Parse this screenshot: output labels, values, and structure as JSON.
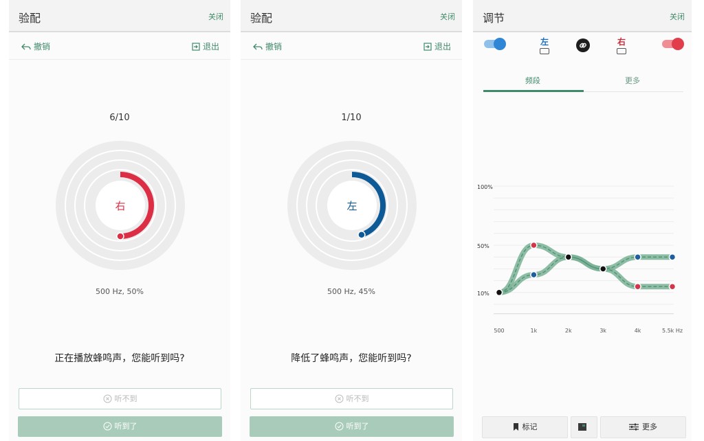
{
  "panels": [
    {
      "title": "验配",
      "close": "关闭",
      "undo": "撤销",
      "exit": "退出",
      "counter": "6/10",
      "ear": "右",
      "ear_color": "#dc2e45",
      "level_fraction": 0.5,
      "freq_info": "500 Hz, 50%",
      "question": "正在播放蜂鸣声，您能听到吗?",
      "btn_no": "听不到",
      "btn_yes": "听到了"
    },
    {
      "title": "验配",
      "close": "关闭",
      "undo": "撤销",
      "exit": "退出",
      "counter": "1/10",
      "ear": "左",
      "ear_color": "#0d5a96",
      "level_fraction": 0.45,
      "freq_info": "500 Hz, 45%",
      "question": "降低了蜂鸣声，您能听到吗?",
      "btn_no": "听不到",
      "btn_yes": "听到了"
    }
  ],
  "adjust": {
    "title": "调节",
    "close": "关闭",
    "left_label": "左",
    "right_label": "右",
    "left_color": "#2f86d6",
    "right_color": "#e23d4a",
    "icons": [
      "toggle-icon",
      "battery-icon",
      "link-icon",
      "bookmark-icon",
      "book-icon",
      "sliders-icon"
    ],
    "tabs": [
      "频段",
      "更多"
    ],
    "bottom": {
      "mark": "标记",
      "more": "更多"
    }
  },
  "chart_data": {
    "type": "line",
    "x": [
      "500",
      "1k",
      "2k",
      "3k",
      "4k",
      "5.5k Hz"
    ],
    "y_ticks": [
      "100%",
      "50%",
      "10%"
    ],
    "ylim": [
      0,
      100
    ],
    "grid": true,
    "series": [
      {
        "values": [
          10,
          25,
          40,
          30,
          40,
          40
        ],
        "color": "#1f5fa0"
      },
      {
        "values": [
          10,
          50,
          40,
          30,
          15,
          15
        ],
        "color": "#d2364a"
      }
    ]
  }
}
